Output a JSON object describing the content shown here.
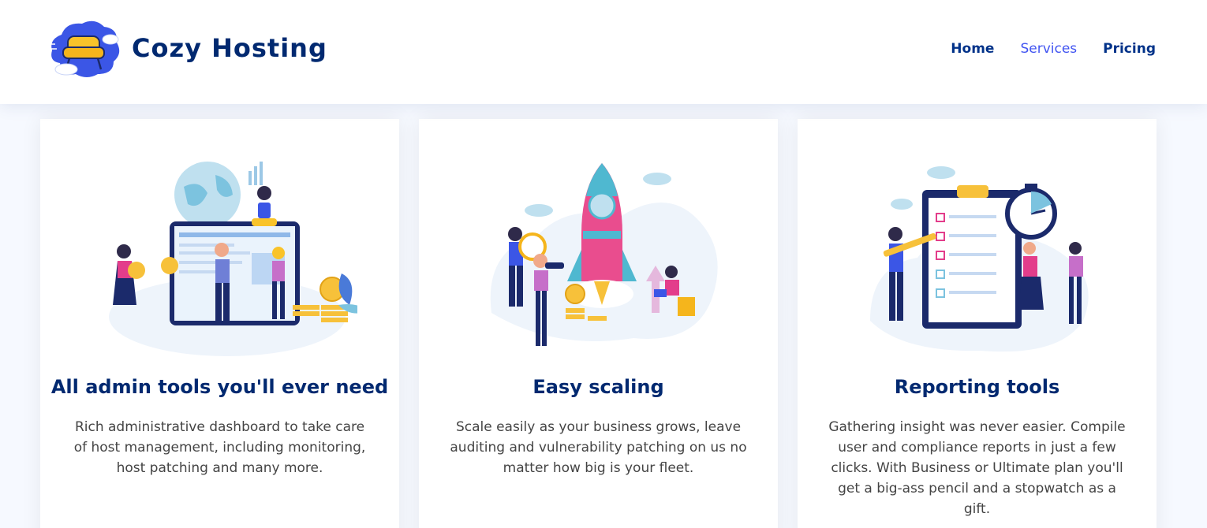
{
  "header": {
    "brand": "Cozy Hosting",
    "nav": [
      {
        "label": "Home",
        "active": false
      },
      {
        "label": "Services",
        "active": true
      },
      {
        "label": "Pricing",
        "active": false
      }
    ]
  },
  "colors": {
    "brand": "#012970",
    "accent": "#4154f1",
    "text": "#444444",
    "background": "#f6f9ff"
  },
  "cards": [
    {
      "illustration": "admin-dashboard-illustration",
      "title": "All admin tools you'll ever need",
      "text": "Rich administrative dashboard to take care of host management, including monitoring, host patching and many more."
    },
    {
      "illustration": "rocket-launch-illustration",
      "title": "Easy scaling",
      "text": "Scale easily as your business grows, leave auditing and vulnerability patching on us no matter how big is your fleet."
    },
    {
      "illustration": "clipboard-checklist-illustration",
      "title": "Reporting tools",
      "text": "Gathering insight was never easier. Compile user and compliance reports in just a few clicks. With Business or Ultimate plan you'll get a big-ass pencil and a stopwatch as a gift."
    }
  ]
}
